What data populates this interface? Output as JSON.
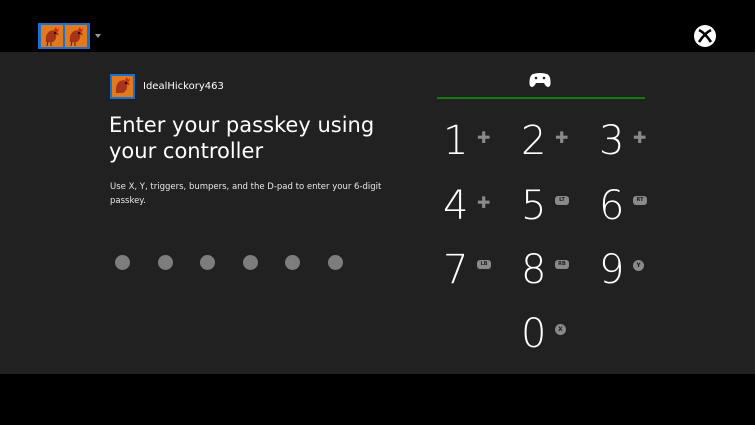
{
  "header": {
    "gamer_pics": [
      "rooster-gamerpic-icon",
      "rooster-gamerpic-icon"
    ],
    "switcher_icon": "chevron-down-icon",
    "logo_icon": "xbox-logo-icon"
  },
  "signin": {
    "gamertag": "IdealHickory463",
    "title_line1": "Enter your passkey using",
    "title_line2": "your controller",
    "instructions": "Use X, Y, triggers, bumpers, and the D-pad to enter your 6-digit passkey.",
    "entered_digits": 0,
    "passkey_length": 6
  },
  "keypad": {
    "controller_icon": "controller-icon",
    "accent_color": "#107c10",
    "keys": [
      {
        "digit": "1",
        "hint": "dpad-up-icon",
        "hint_label": ""
      },
      {
        "digit": "2",
        "hint": "dpad-right-icon",
        "hint_label": ""
      },
      {
        "digit": "3",
        "hint": "dpad-down-icon",
        "hint_label": ""
      },
      {
        "digit": "4",
        "hint": "dpad-left-icon",
        "hint_label": ""
      },
      {
        "digit": "5",
        "hint": "left-trigger-icon",
        "hint_label": "LT"
      },
      {
        "digit": "6",
        "hint": "right-trigger-icon",
        "hint_label": "RT"
      },
      {
        "digit": "7",
        "hint": "left-bumper-icon",
        "hint_label": "LB"
      },
      {
        "digit": "8",
        "hint": "right-bumper-icon",
        "hint_label": "RB"
      },
      {
        "digit": "9",
        "hint": "y-button-icon",
        "hint_label": "Y"
      },
      {
        "digit": "0",
        "hint": "x-button-icon",
        "hint_label": "X"
      }
    ]
  }
}
